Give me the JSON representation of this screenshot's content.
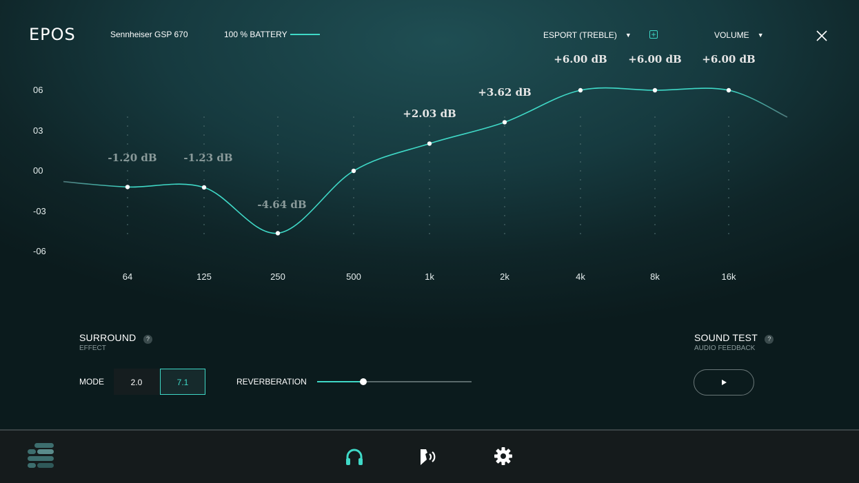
{
  "header": {
    "logo": "EPOS",
    "device_name": "Sennheiser GSP 670",
    "battery": "100 % BATTERY",
    "preset": "ESPORT (TREBLE)",
    "volume": "VOLUME",
    "preset_icon": "caret-down-icon",
    "add_icon": "plus-square-icon",
    "close_icon": "close-icon"
  },
  "equalizer": {
    "y_labels": [
      "06",
      "03",
      "00",
      "-03",
      "-06"
    ],
    "bands": [
      {
        "freq": "64",
        "gain": -1.2,
        "label": "-1.20 dB"
      },
      {
        "freq": "125",
        "gain": -1.23,
        "label": "-1.23 dB"
      },
      {
        "freq": "250",
        "gain": -4.64,
        "label": "-4.64 dB"
      },
      {
        "freq": "500",
        "gain": 0,
        "label": ""
      },
      {
        "freq": "1k",
        "gain": 2.03,
        "label": "+2.03 dB"
      },
      {
        "freq": "2k",
        "gain": 3.62,
        "label": "+3.62 dB"
      },
      {
        "freq": "4k",
        "gain": 6.0,
        "label": "+6.00 dB"
      },
      {
        "freq": "8k",
        "gain": 6.0,
        "label": "+6.00 dB"
      },
      {
        "freq": "16k",
        "gain": 6.0,
        "label": "+6.00 dB"
      }
    ],
    "ylim": [
      -6,
      6
    ],
    "curve_color": "#3fd9c7"
  },
  "surround": {
    "title": "SURROUND",
    "subtitle": "EFFECT",
    "help": "?",
    "mode_label": "MODE",
    "modes": [
      "2.0",
      "7.1"
    ],
    "active_mode": "7.1",
    "reverb_label": "REVERBERATION",
    "reverb_value": 0.3
  },
  "sound_test": {
    "title": "SOUND TEST",
    "subtitle": "AUDIO FEEDBACK",
    "help": "?",
    "play_icon": "play-icon"
  },
  "bottom_nav": {
    "menu_icon": "menu-icon",
    "items": [
      "headphones-icon",
      "microphone-voice-icon",
      "gear-icon"
    ],
    "active": "headphones-icon"
  },
  "colors": {
    "accent": "#3fd9c7"
  }
}
